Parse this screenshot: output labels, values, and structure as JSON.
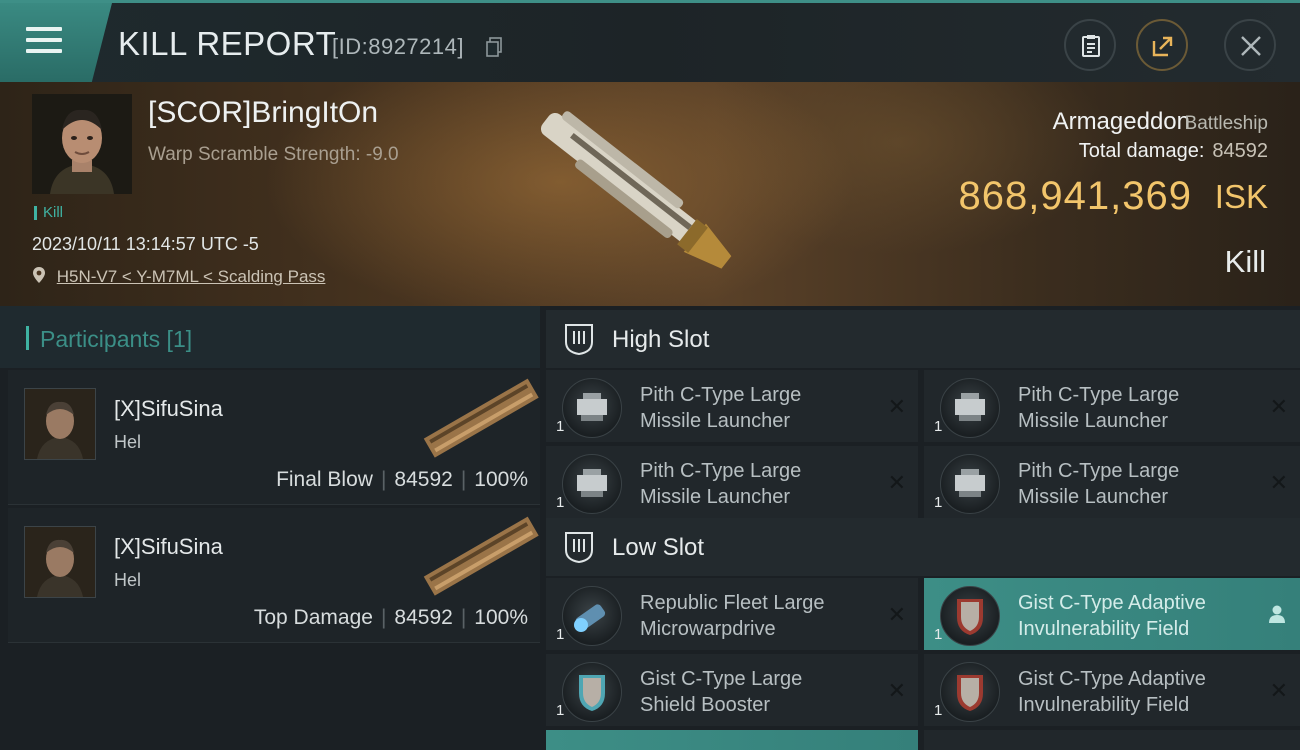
{
  "header": {
    "title": "KILL REPORT",
    "report_id": "[ID:8927214]"
  },
  "victim": {
    "name": "[SCOR]BringItOn",
    "warp_scramble": "Warp Scramble Strength: -9.0",
    "tag": "Kill",
    "datetime": "2023/10/11 13:14:57 UTC -5",
    "location": "H5N-V7 < Y-M7ML < Scalding Pass",
    "ship_name": "Armageddon",
    "ship_class": "Battleship",
    "total_damage_label": "Total damage:",
    "total_damage": "84592",
    "isk_value": "868,941,369",
    "isk_unit": "ISK",
    "result": "Kill"
  },
  "participants": {
    "title": "Participants [1]",
    "items": [
      {
        "name": "[X]SifuSina",
        "ship": "Hel",
        "role": "Final Blow",
        "damage": "84592",
        "percent": "100%"
      },
      {
        "name": "[X]SifuSina",
        "ship": "Hel",
        "role": "Top Damage",
        "damage": "84592",
        "percent": "100%"
      }
    ]
  },
  "slots": {
    "high": {
      "title": "High Slot",
      "modules": [
        {
          "line1": "Pith C-Type Large",
          "line2": "Missile Launcher",
          "qty": "1"
        },
        {
          "line1": "Pith C-Type Large",
          "line2": "Missile Launcher",
          "qty": "1"
        },
        {
          "line1": "Pith C-Type Large",
          "line2": "Missile Launcher",
          "qty": "1"
        },
        {
          "line1": "Pith C-Type Large",
          "line2": "Missile Launcher",
          "qty": "1"
        }
      ]
    },
    "low": {
      "title": "Low Slot",
      "modules": [
        {
          "line1": "Republic Fleet Large",
          "line2": "Microwarpdrive",
          "qty": "1"
        },
        {
          "line1": "Gist C-Type Adaptive",
          "line2": "Invulnerability Field",
          "qty": "1"
        },
        {
          "line1": "Gist C-Type Large",
          "line2": "Shield Booster",
          "qty": "1"
        },
        {
          "line1": "Gist C-Type Adaptive",
          "line2": "Invulnerability Field",
          "qty": "1"
        }
      ]
    }
  },
  "colors": {
    "accent": "#3fb3a3",
    "isk": "#f2c56b",
    "highlight_row": "#3d8e86"
  }
}
